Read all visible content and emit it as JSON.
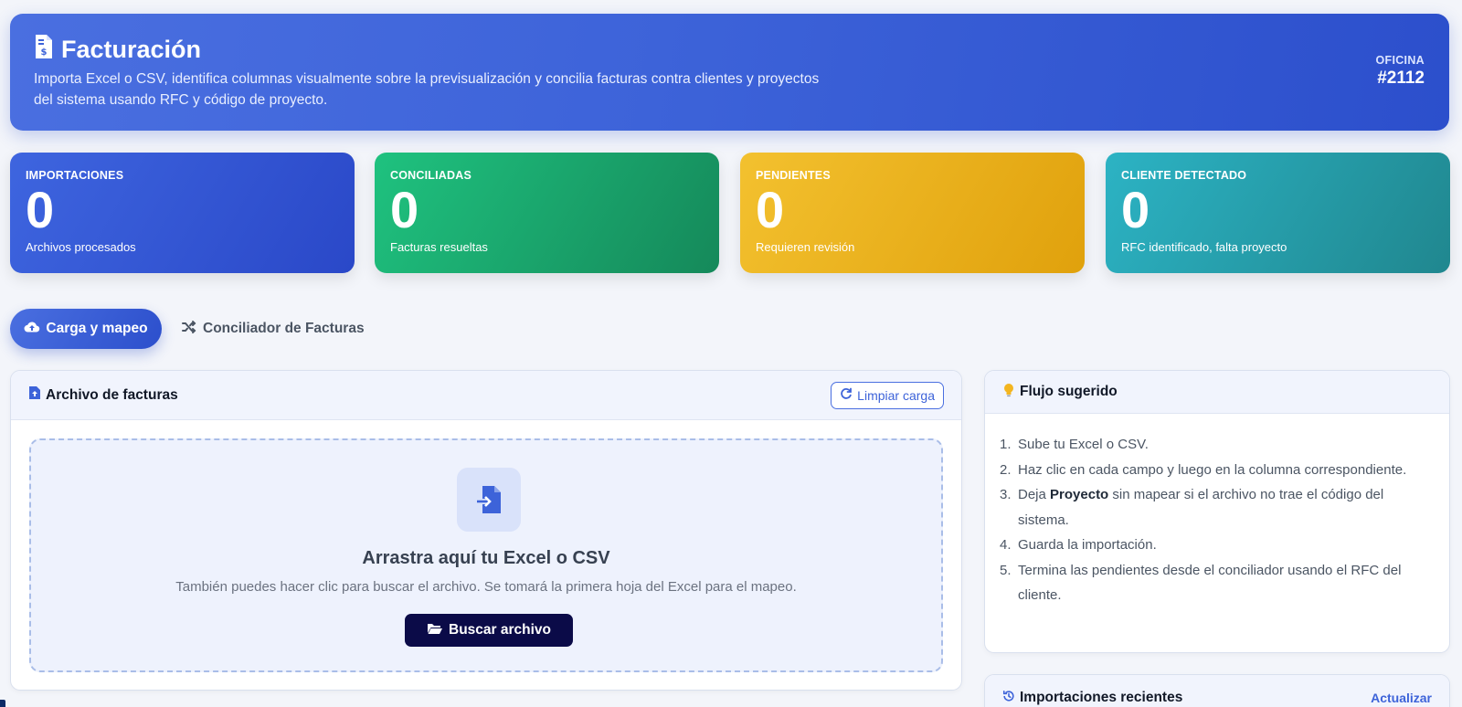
{
  "header": {
    "title": "Facturación",
    "description": "Importa Excel o CSV, identifica columnas visualmente sobre la previsualización y concilia facturas contra clientes y proyectos del sistema usando RFC y código de proyecto.",
    "office_label": "OFICINA",
    "office_value": "#2112"
  },
  "stats": [
    {
      "label": "IMPORTACIONES",
      "value": "0",
      "caption": "Archivos procesados",
      "color": "#3e65df"
    },
    {
      "label": "CONCILIADAS",
      "value": "0",
      "caption": "Facturas resueltas",
      "color": "#1fc27f"
    },
    {
      "label": "PENDIENTES",
      "value": "0",
      "caption": "Requieren revisión",
      "color": "#f3c12f"
    },
    {
      "label": "CLIENTE DETECTADO",
      "value": "0",
      "caption": "RFC identificado, falta proyecto",
      "color": "#2cb3c4"
    }
  ],
  "tabs": [
    {
      "label": "Carga y mapeo",
      "icon": "cloud-upload-icon",
      "active": true
    },
    {
      "label": "Conciliador de Facturas",
      "icon": "shuffle-icon",
      "active": false
    }
  ],
  "upload": {
    "title": "Archivo de facturas",
    "clear_label": "Limpiar carga",
    "drop_title": "Arrastra aquí tu Excel o CSV",
    "drop_subtitle": "También puedes hacer clic para buscar el archivo. Se tomará la primera hoja del Excel para el mapeo.",
    "browse_label": "Buscar archivo"
  },
  "flow": {
    "title": "Flujo sugerido",
    "steps": [
      {
        "text": "Sube tu Excel o CSV."
      },
      {
        "text": "Haz clic en cada campo y luego en la columna correspondiente."
      },
      {
        "before": "Deja ",
        "bold": "Proyecto",
        "after": " sin mapear si el archivo no trae el código del sistema."
      },
      {
        "text": "Guarda la importación."
      },
      {
        "text": "Termina las pendientes desde el conciliador usando el RFC del cliente."
      }
    ]
  },
  "recent": {
    "title": "Importaciones recientes",
    "refresh_label": "Actualizar"
  },
  "colors": {
    "primary": "#3d63d9",
    "dark_button": "#0b0b48",
    "bulb": "#f3b51f"
  }
}
